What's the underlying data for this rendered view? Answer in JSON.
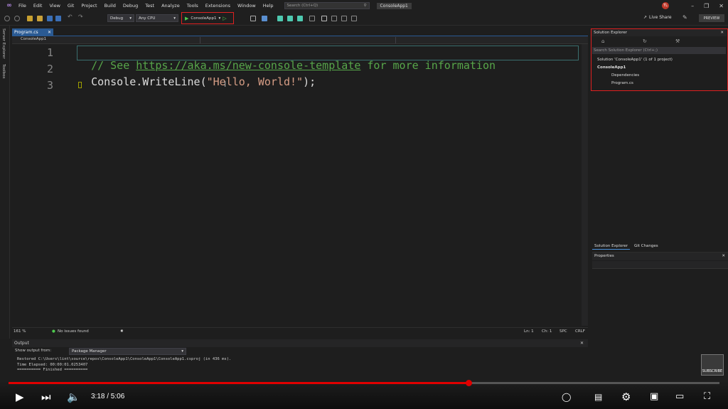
{
  "menu": {
    "items": [
      "File",
      "Edit",
      "View",
      "Git",
      "Project",
      "Build",
      "Debug",
      "Test",
      "Analyze",
      "Tools",
      "Extensions",
      "Window",
      "Help"
    ],
    "search_placeholder": "Search (Ctrl+Q)",
    "solution_name": "ConsoleApp1",
    "user_initials": "TL"
  },
  "toolbar": {
    "config": "Debug",
    "platform": "Any CPU",
    "run_target": "ConsoleApp1",
    "live_share": "Live Share",
    "preview": "PREVIEW"
  },
  "left_rail": {
    "server_explorer": "Server Explorer",
    "toolbox": "Toolbox"
  },
  "editor": {
    "tab": "Program.cs",
    "nav_project": "ConsoleApp1",
    "lines": [
      {
        "num": "1",
        "comment_prefix": "// See ",
        "link": "https://aka.ms/new-console-template",
        "comment_suffix": " for more information"
      },
      {
        "num": "2",
        "type": "Console",
        "method": ".WriteLine(",
        "string": "\"Hello, World!\"",
        "tail": ");"
      },
      {
        "num": "3"
      }
    ]
  },
  "editor_status": {
    "zoom": "161 %",
    "issues": "No issues found",
    "ln": "Ln: 1",
    "ch": "Ch: 1",
    "spc": "SPC",
    "crlf": "CRLF"
  },
  "output": {
    "title": "Output",
    "show_from_label": "Show output from:",
    "source": "Package Manager",
    "lines": [
      "Restored C:\\Users\\lint\\source\\repos\\ConsoleApp1\\ConsoleApp1\\ConsoleApp1.csproj (in 436 ms).",
      "Time Elapsed: 00:00:01.0253407",
      "========== Finished =========="
    ]
  },
  "solution_explorer": {
    "title": "Solution Explorer",
    "search_placeholder": "Search Solution Explorer (Ctrl+;)",
    "solution": "Solution 'ConsoleApp1' (1 of 1 project)",
    "project": "ConsoleApp1",
    "dependencies": "Dependencies",
    "file": "Program.cs",
    "tabs": [
      "Solution Explorer",
      "Git Changes"
    ]
  },
  "properties": {
    "title": "Properties"
  },
  "watermark": {
    "subscribe": "SUBSCRIBE"
  },
  "player": {
    "time": "3:18 / 5:06",
    "progress_fraction": 0.647,
    "accent": "#e00000"
  }
}
